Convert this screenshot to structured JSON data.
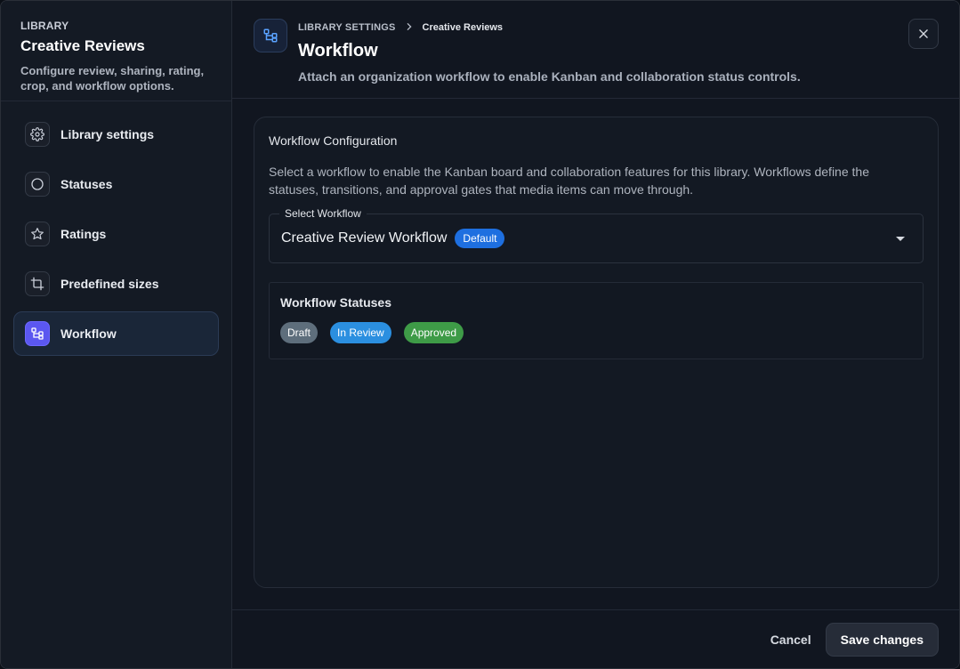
{
  "sidebar": {
    "eyebrow": "LIBRARY",
    "title": "Creative Reviews",
    "description": "Configure review, sharing, rating, crop, and workflow options.",
    "items": [
      {
        "label": "Library settings",
        "icon": "gear-icon"
      },
      {
        "label": "Statuses",
        "icon": "circle-icon"
      },
      {
        "label": "Ratings",
        "icon": "star-icon"
      },
      {
        "label": "Predefined sizes",
        "icon": "crop-icon"
      },
      {
        "label": "Workflow",
        "icon": "workflow-icon",
        "active": true
      }
    ]
  },
  "header": {
    "breadcrumb": [
      "LIBRARY SETTINGS",
      "Creative Reviews"
    ],
    "title": "Workflow",
    "description": "Attach an organization workflow to enable Kanban and collaboration status controls."
  },
  "card": {
    "title": "Workflow Configuration",
    "description": "Select a workflow to enable the Kanban board and collaboration features for this library. Workflows define the statuses, transitions, and approval gates that media items can move through.",
    "select": {
      "label": "Select Workflow",
      "value": "Creative Review Workflow",
      "badge": "Default"
    },
    "statuses": {
      "title": "Workflow Statuses",
      "items": [
        {
          "label": "Draft",
          "color": "#5e6e7c"
        },
        {
          "label": "In Review",
          "color": "#2b8fe0"
        },
        {
          "label": "Approved",
          "color": "#3e9b47"
        }
      ]
    }
  },
  "footer": {
    "cancel_label": "Cancel",
    "save_label": "Save changes"
  },
  "colors": {
    "accent": "#5b57f0",
    "default_badge": "#1e6fe0"
  }
}
